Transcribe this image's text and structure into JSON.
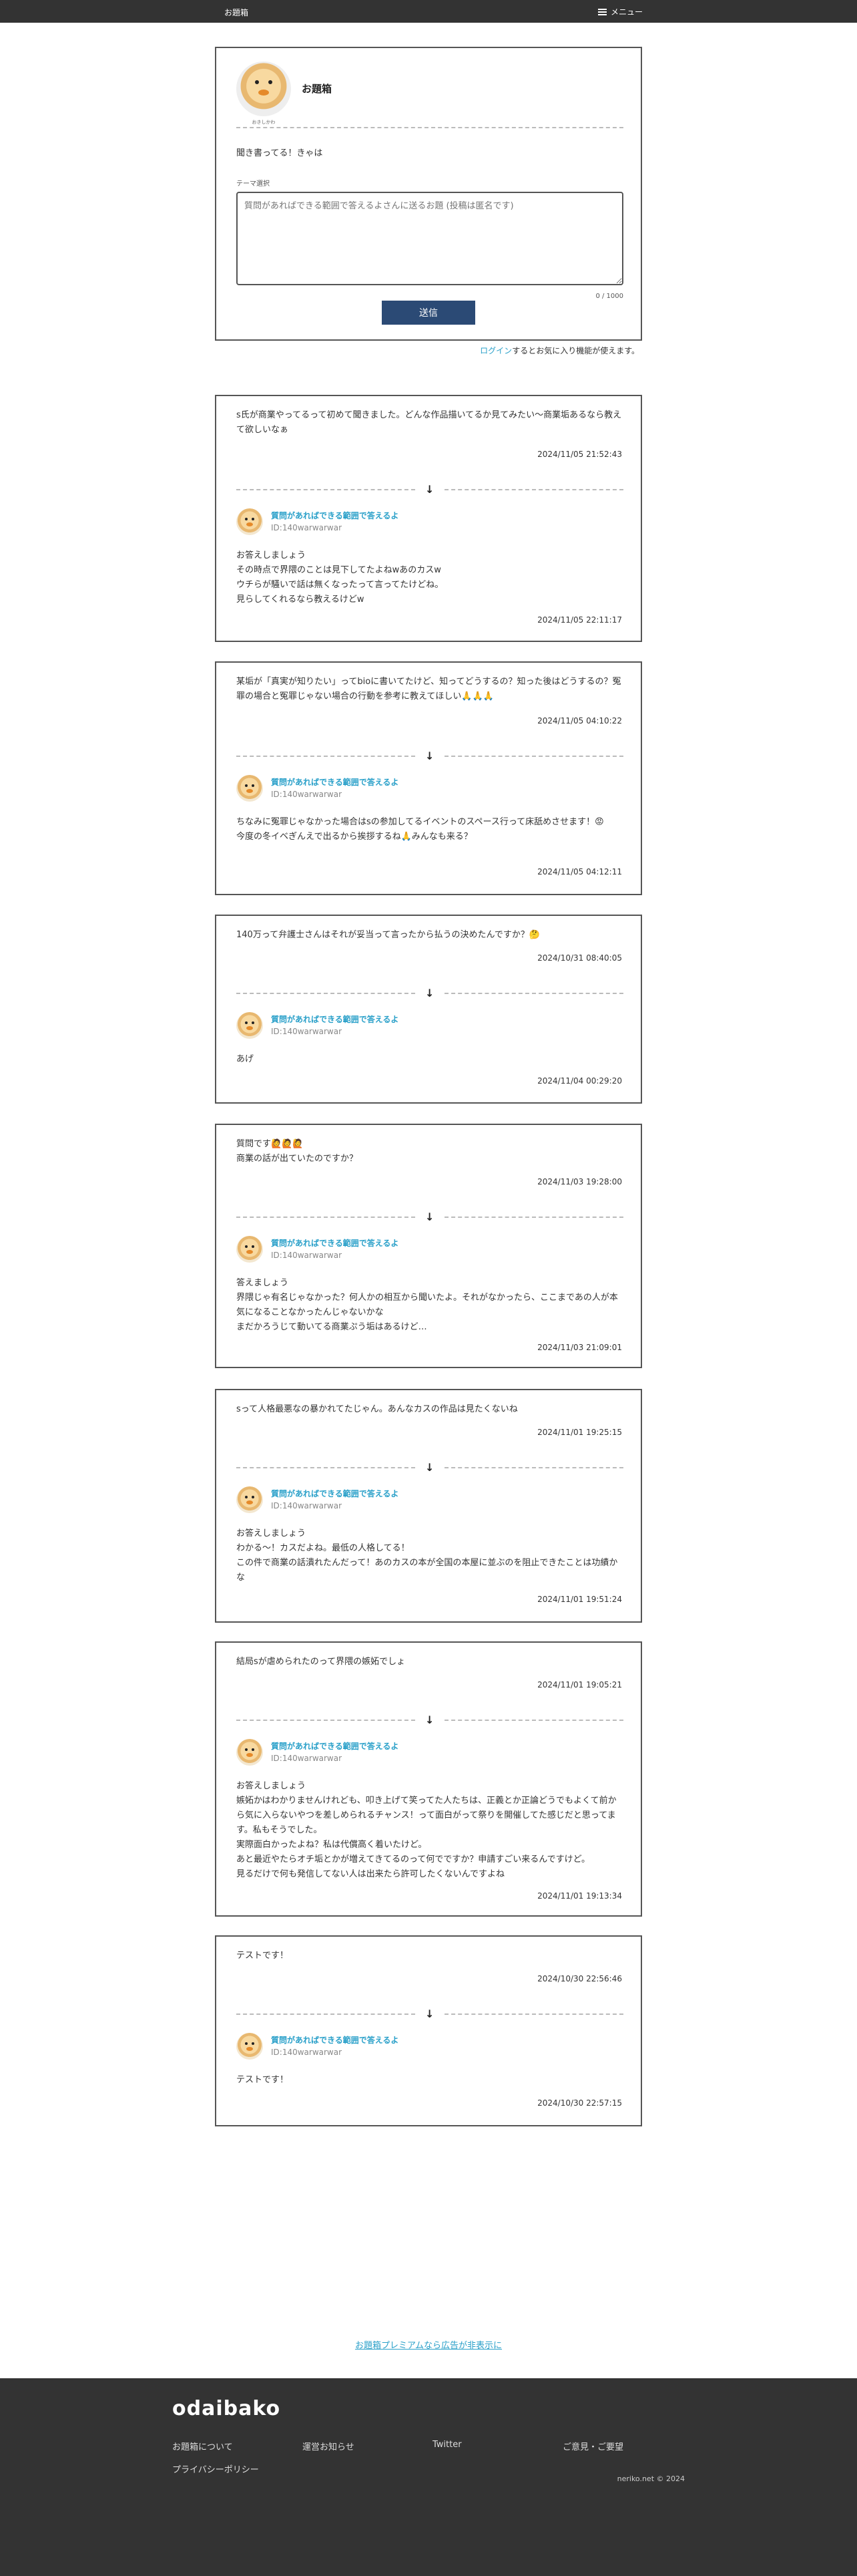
{
  "topbar": {
    "title": "お題箱",
    "menu_label": "メニュー"
  },
  "ask": {
    "owner_caption": "おきしかわ",
    "box_name": "お題箱",
    "greeting": "聞き書ってる！きゃは",
    "theme_label": "テーマ選択",
    "placeholder": "質問があればできる範囲で答えるよさんに送るお題 (投稿は匿名です)",
    "counter": "0 / 1000",
    "send_label": "送信"
  },
  "login_note": {
    "link": "ログイン",
    "rest": "するとお気に入り機能が使えます。"
  },
  "posts": [
    {
      "q": "s氏が商業やってるって初めて聞きました。どんな作品描いてるか見てみたい〜商業垢あるなら教えて欲しいなぁ",
      "q_date": "2024/11/05 21:52:43",
      "answerer": "質問があればできる範囲で答えるよ",
      "id": "ID:140warwarwar",
      "a": "お答えしましょう\nその時点で界隈のことは見下してたよねwあのカスw\nウチらが騒いで話は無くなったって言ってたけどね。\n見らしてくれるなら教えるけどw",
      "a_date": "2024/11/05 22:11:17"
    },
    {
      "q": "某垢が「真実が知りたい」ってbioに書いてたけど、知ってどうするの？知った後はどうするの？冤罪の場合と冤罪じゃない場合の行動を参考に教えてほしい🙏🙏🙏",
      "q_date": "2024/11/05 04:10:22",
      "answerer": "質問があればできる範囲で答えるよ",
      "id": "ID:140warwarwar",
      "a": "ちなみに冤罪じゃなかった場合はsの参加してるイベントのスペース行って床舐めさせます！😡\n今度の冬イベぎんえで出るから挨拶するね🙏みんなも来る？",
      "a_date": "2024/11/05 04:12:11"
    },
    {
      "q": "140万って弁護士さんはそれが妥当って言ったから払うの決めたんですか？🤔",
      "q_date": "2024/10/31 08:40:05",
      "answerer": "質問があればできる範囲で答えるよ",
      "id": "ID:140warwarwar",
      "a": "あげ",
      "a_date": "2024/11/04 00:29:20"
    },
    {
      "q": "質問です🙋🙋🙋\n商業の話が出ていたのですか？",
      "q_date": "2024/11/03 19:28:00",
      "answerer": "質問があればできる範囲で答えるよ",
      "id": "ID:140warwarwar",
      "a": "答えましょう\n界隈じゃ有名じゃなかった？何人かの相互から聞いたよ。それがなかったら、ここまであの人が本気になることなかったんじゃないかな\nまだかろうじて動いてる商業ぷう垢はあるけど…",
      "a_date": "2024/11/03 21:09:01"
    },
    {
      "q": "sって人格最悪なの暴かれてたじゃん。あんなカスの作品は見たくないね",
      "q_date": "2024/11/01 19:25:15",
      "answerer": "質問があればできる範囲で答えるよ",
      "id": "ID:140warwarwar",
      "a": "お答えしましょう\nわかる〜！カスだよね。最低の人格してる！\nこの件で商業の話潰れたんだって！あのカスの本が全国の本屋に並ぶのを阻止できたことは功績かな",
      "a_date": "2024/11/01 19:51:24"
    },
    {
      "q": "結局sが虐められたのって界隈の嫉妬でしょ",
      "q_date": "2024/11/01 19:05:21",
      "answerer": "質問があればできる範囲で答えるよ",
      "id": "ID:140warwarwar",
      "a": "お答えしましょう\n嫉妬かはわかりませんけれども、叩き上げて笑ってた人たちは、正義とか正論どうでもよくて前から気に入らないやつを差しめられるチャンス！って面白がって祭りを開催してた感じだと思ってます。私もそうでした。\n実際面白かったよね？私は代償高く着いたけど。\nあと最近やたらオチ垢とかが増えてきてるのって何でですか？申請すごい来るんですけど。\n見るだけで何も発信してない人は出来たら許可したくないんですよね",
      "a_date": "2024/11/01 19:13:34"
    },
    {
      "q": "テストです！",
      "q_date": "2024/10/30 22:56:46",
      "answerer": "質問があればできる範囲で答えるよ",
      "id": "ID:140warwarwar",
      "a": "テストです！",
      "a_date": "2024/10/30 22:57:15"
    }
  ],
  "premium_link": "お題箱プレミアムなら広告が非表示に",
  "footer": {
    "logo": "odaibako",
    "links": [
      "お題箱について",
      "運営お知らせ",
      "Twitter",
      "ご意見・ご要望",
      "プライバシーポリシー"
    ],
    "copyright": "neriko.net © 2024"
  }
}
